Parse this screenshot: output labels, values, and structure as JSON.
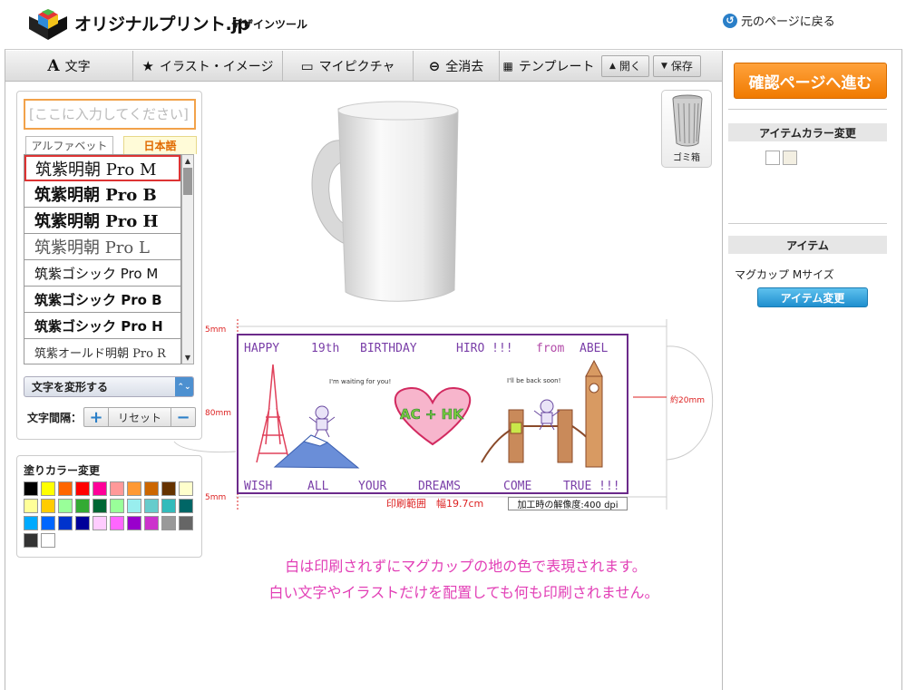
{
  "header": {
    "logo_text": "オリジナルプリント.jp",
    "logo_sub": "デザインツール",
    "back_link": "元のページに戻る"
  },
  "toolbar": {
    "text": "文字",
    "illust": "イラスト・イメージ",
    "mypicture": "マイピクチャ",
    "clear": "全消去",
    "template": "テンプレート",
    "open": "開く",
    "save": "保存"
  },
  "text_panel": {
    "placeholder": "[ここに入力してください]",
    "tab_alpha": "アルファベット",
    "tab_japanese": "日本語",
    "fonts": [
      "筑紫明朝 Pro M",
      "筑紫明朝 Pro B",
      "筑紫明朝 Pro H",
      "筑紫明朝 Pro L",
      "筑紫ゴシック Pro M",
      "筑紫ゴシック Pro B",
      "筑紫ゴシック Pro H",
      "筑紫オールド明朝 Pro R"
    ],
    "transform": "文字を変形する",
    "spacing_label": "文字間隔：",
    "reset": "リセット"
  },
  "color_panel": {
    "title": "塗りカラー変更",
    "colors": [
      "#000000",
      "#ffff00",
      "#ff6600",
      "#ff0000",
      "#ff0099",
      "#ff9999",
      "#ff9933",
      "#cc6600",
      "#663300",
      "#ffffcc",
      "#ffff99",
      "#ffcc00",
      "#99ff99",
      "#33aa33",
      "#006633",
      "#99ff99",
      "#99eeee",
      "#66cccc",
      "#33bbbb",
      "#006666",
      "#00aaff",
      "#0066ff",
      "#0033cc",
      "#000099",
      "#ffccff",
      "#ff66ff",
      "#9900cc",
      "#cc33cc",
      "#999999",
      "#666666",
      "#333333",
      "#ffffff"
    ]
  },
  "canvas": {
    "trash_label": "ゴミ箱",
    "dim_top": "5mm",
    "dim_height": "80mm",
    "dim_bottom": "5mm",
    "dim_handle": "約20mm",
    "print_range": "印刷範囲　幅19.7cm",
    "dpi": "加工時の解像度:400 dpi",
    "design": {
      "top_words": [
        "HAPPY",
        "19th",
        "BIRTHDAY",
        "HIRO !!!",
        "from",
        "ABEL"
      ],
      "bottom_words": [
        "WISH",
        "ALL",
        "YOUR",
        "DREAMS",
        "COME",
        "TRUE !!!"
      ],
      "bubble1": "I'm waiting for you!",
      "bubble2": "I'll be back soon!",
      "heart_text": "AC + HK"
    },
    "notice_line1": "白は印刷されずにマグカップの地の色で表現されます。",
    "notice_line2": "白い文字やイラストだけを配置しても何も印刷されません。"
  },
  "right": {
    "confirm": "確認ページへ進む",
    "item_color_title": "アイテムカラー変更",
    "item_colors": [
      "#ffffff",
      "#f3efe2"
    ],
    "item_title": "アイテム",
    "item_name": "マグカップ Mサイズ",
    "item_change": "アイテム変更"
  }
}
